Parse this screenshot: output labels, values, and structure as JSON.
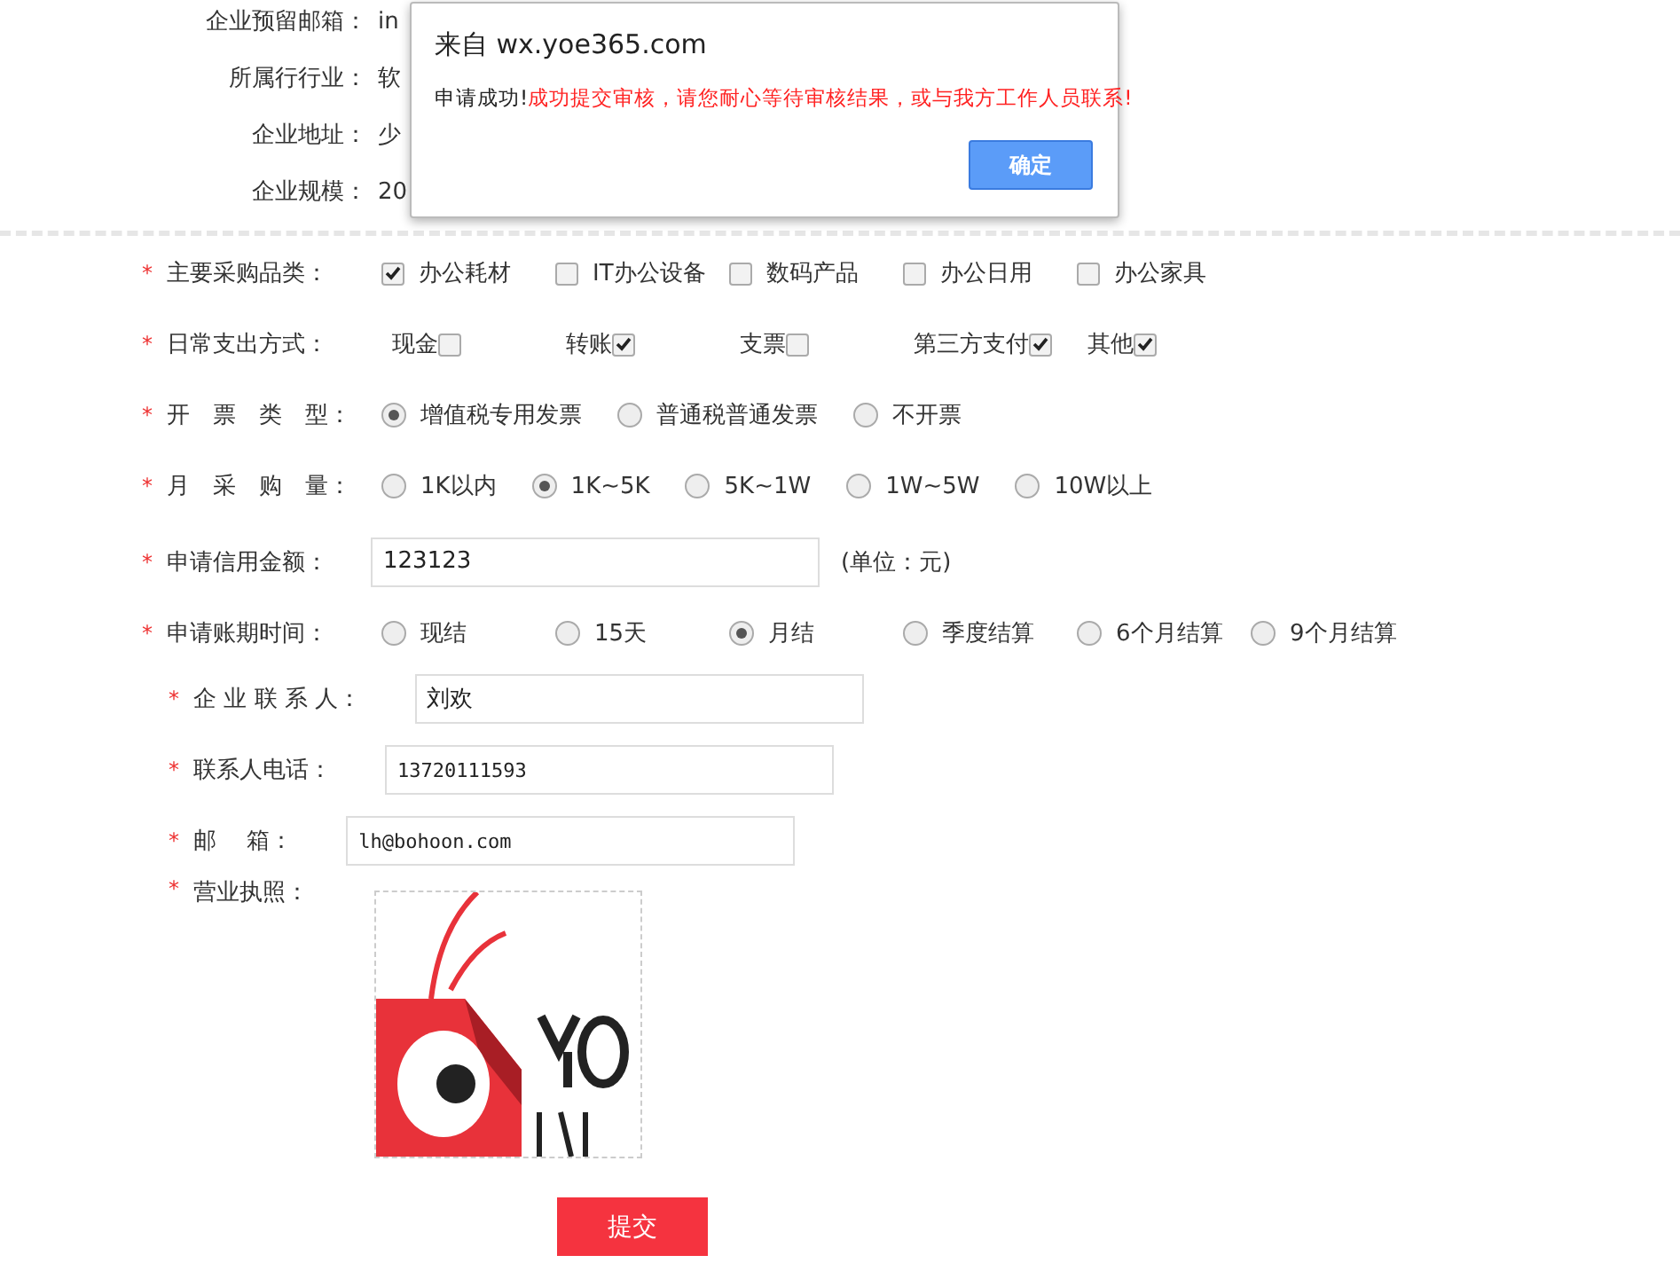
{
  "company_info": [
    {
      "label": "企业预留邮箱：",
      "value": "in"
    },
    {
      "label": "所属行行业：",
      "value": "软"
    },
    {
      "label": "企业地址：",
      "value": "少"
    },
    {
      "label": "企业规模：",
      "value": "20"
    }
  ],
  "main_fields": [
    {
      "kind": "checkbox",
      "label": "主要采购品类：",
      "options": [
        {
          "label": "办公耗材",
          "checked": true
        },
        {
          "label": "IT办公设备",
          "checked": false
        },
        {
          "label": "数码产品",
          "checked": false
        },
        {
          "label": "办公日用",
          "checked": false
        },
        {
          "label": "办公家具",
          "checked": false
        }
      ]
    },
    {
      "kind": "checkbox_after",
      "label": "日常支出方式：",
      "options": [
        {
          "label": "现金",
          "checked": false
        },
        {
          "label": "转账",
          "checked": true
        },
        {
          "label": "支票",
          "checked": false
        },
        {
          "label": "第三方支付",
          "checked": true
        },
        {
          "label": "其他",
          "checked": true
        }
      ]
    },
    {
      "kind": "radio",
      "label": "开　票　类　型：",
      "options": [
        {
          "label": "增值税专用发票",
          "selected": true
        },
        {
          "label": "普通税普通发票",
          "selected": false
        },
        {
          "label": "不开票",
          "selected": false
        }
      ]
    },
    {
      "kind": "radio",
      "label": "月　采　购　量：",
      "options": [
        {
          "label": "1K以内",
          "selected": false
        },
        {
          "label": "1K~5K",
          "selected": true
        },
        {
          "label": "5K~1W",
          "selected": false
        },
        {
          "label": "1W~5W",
          "selected": false
        },
        {
          "label": "10W以上",
          "selected": false
        }
      ]
    },
    {
      "kind": "input",
      "label": "申请信用金额：",
      "value": "123123",
      "unit": "(单位：元)"
    },
    {
      "kind": "radio_grid",
      "label": "申请账期时间：",
      "options": [
        {
          "label": "现结",
          "selected": false
        },
        {
          "label": "15天",
          "selected": false
        },
        {
          "label": "月结",
          "selected": true
        },
        {
          "label": "季度结算",
          "selected": false
        },
        {
          "label": "6个月结算",
          "selected": false
        },
        {
          "label": "9个月结算",
          "selected": false
        }
      ]
    }
  ],
  "contact_fields": [
    {
      "kind": "input",
      "label": "企 业 联 系 人：",
      "value": "刘欢"
    },
    {
      "kind": "mono_input",
      "label": "联系人电话：",
      "value": "13720111593"
    },
    {
      "kind": "mono_input",
      "label": "邮　 箱：",
      "value": "lh@bohoon.com"
    },
    {
      "kind": "upload",
      "label": "营业执照："
    }
  ],
  "required_mark": "*",
  "submit_button": "提交",
  "dialog": {
    "title": "来自 wx.yoe365.com",
    "message_prefix": "申请成功!",
    "message_detail": "成功提交审核，请您耐心等待审核结果，或与我方工作人员联系!",
    "ok_button": "确定"
  }
}
